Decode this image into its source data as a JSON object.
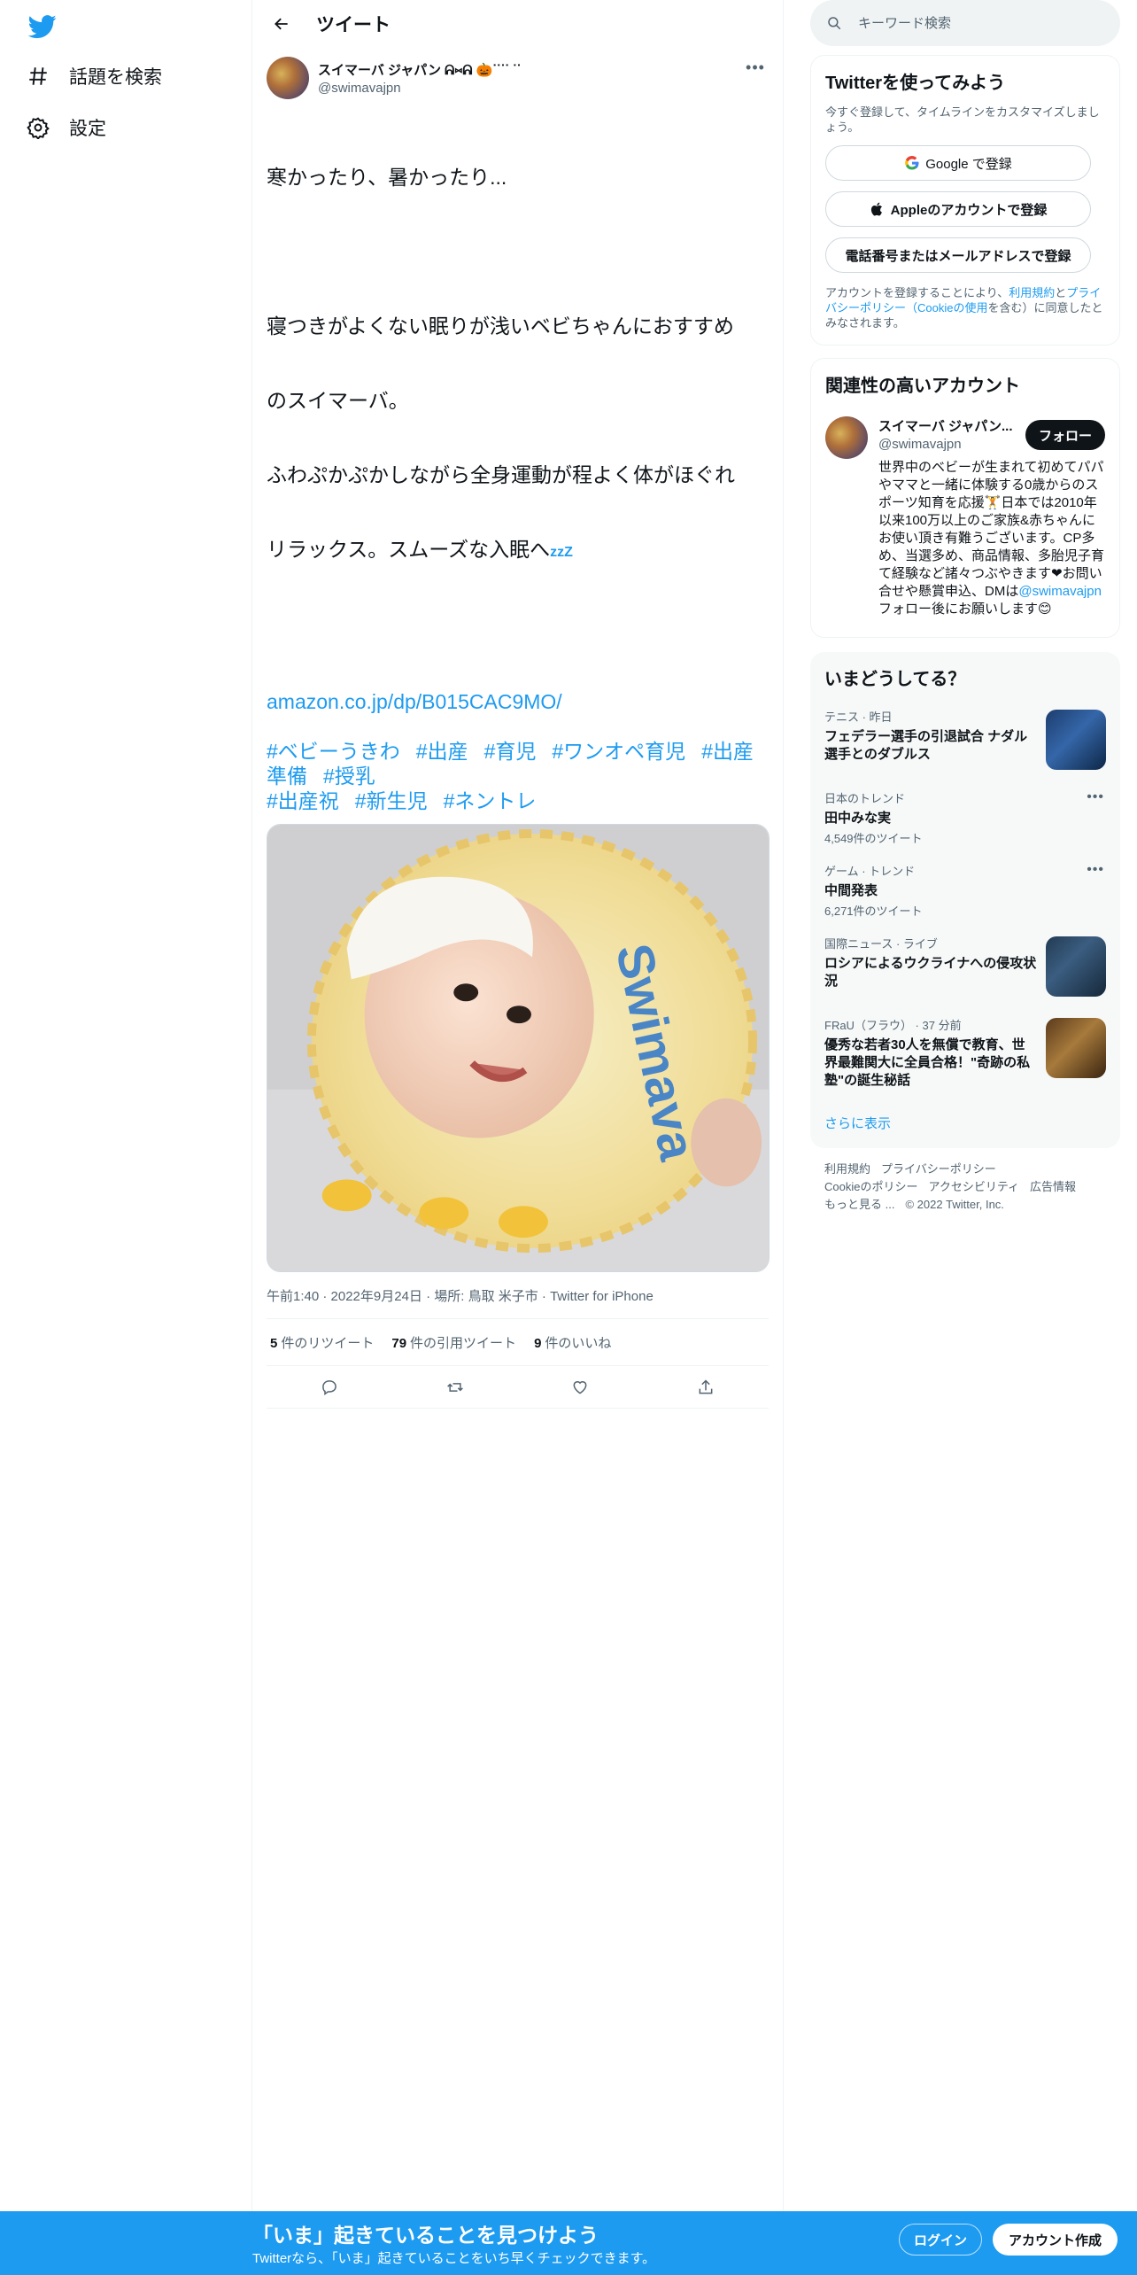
{
  "nav": {
    "logo_icon": "twitter-bird-icon",
    "items": [
      {
        "label": "話題を検索",
        "icon": "hashtag-icon"
      },
      {
        "label": "設定",
        "icon": "gear-icon"
      }
    ]
  },
  "header": {
    "title": "ツイート",
    "back_icon": "arrow-left-icon"
  },
  "tweet": {
    "author_name": "スイマーバ ジャパン ᕱ⑅ᕱ 🎃ᐝᐝᐝᐝ ᐝᐝ",
    "author_handle": "@swimavajpn",
    "text_lines": [
      "寒かったり、暑かったり...",
      "",
      "寝つきがよくない眠りが浅いベビちゃんにおすすめ",
      "のスイマーバ。",
      "ふわぷかぷかしながら全身運動が程よく体がほぐれ",
      "リラックス。スムーズな入眠へ",
      ""
    ],
    "zzz": "zzZ",
    "link": "amazon.co.jp/dp/B015CAC9MO/",
    "hashtags": [
      "#ベビーうきわ",
      "#出産",
      "#育児",
      "#ワンオペ育児",
      "#出産準備",
      "#授乳",
      "#出産祝",
      "#新生児",
      "#ネントレ"
    ],
    "media_caption": "Swimava",
    "meta": "午前1:40 · 2022年9月24日 · 場所: 鳥取 米子市 · Twitter for iPhone",
    "retweets_count": "5",
    "retweets_label": "件のリツイート",
    "quotes_count": "79",
    "quotes_label": "件の引用ツイート",
    "likes_count": "9",
    "likes_label": "件のいいね"
  },
  "search": {
    "placeholder": "キーワード検索"
  },
  "signup": {
    "title": "Twitterを使ってみよう",
    "subtitle": "今すぐ登録して、タイムラインをカスタマイズしましょう。",
    "google_label": "Google で登録",
    "apple_label": "Appleのアカウントで登録",
    "phone_label": "電話番号またはメールアドレスで登録",
    "terms_prefix": "アカウントを登録することにより、",
    "terms_link1": "利用規約",
    "terms_mid": "と",
    "terms_link2": "プライバシーポリシー（Cookieの使用",
    "terms_suffix": "を含む）に同意したとみなされます。"
  },
  "related": {
    "title": "関連性の高いアカウント",
    "name": "スイマーバ ジャパン...",
    "handle": "@swimavajpn",
    "follow_label": "フォロー",
    "bio": "世界中のベビーが生まれて初めてパパやママと一緒に体験する0歳からのスポーツ知育を応援🏋日本では2010年以来100万以上のご家族&赤ちゃんにお使い頂き有難うございます。CP多め、当選多め、商品情報、多胎児子育て経験など諸々つぶやきます❤お問い合せや懸賞申込、DMは",
    "bio_link": "@swimavajpn",
    "bio_suffix": "フォロー後にお願いします😊"
  },
  "trends": {
    "title": "いまどうしてる？",
    "items": [
      {
        "meta": "テニス · 昨日",
        "title": "フェデラー選手の引退試合 ナダル選手とのダブルス",
        "count": "",
        "has_thumb": true
      },
      {
        "meta": "日本のトレンド",
        "title": "田中みな実",
        "count": "4,549件のツイート",
        "has_thumb": false
      },
      {
        "meta": "ゲーム · トレンド",
        "title": "中間発表",
        "count": "6,271件のツイート",
        "has_thumb": false
      },
      {
        "meta": "国際ニュース · ライブ",
        "title": "ロシアによるウクライナへの侵攻状況",
        "count": "",
        "has_thumb": true
      },
      {
        "meta": "FRaU（フラウ） · 37 分前",
        "title": "優秀な若者30人を無償で教育、世界最難関大に全員合格！\"奇跡の私塾\"の誕生秘話",
        "count": "",
        "has_thumb": true
      }
    ],
    "show_more": "さらに表示"
  },
  "footer": {
    "links": [
      "利用規約",
      "プライバシーポリシー",
      "Cookieのポリシー",
      "アクセシビリティ",
      "広告情報",
      "もっと見る ...",
      "© 2022 Twitter, Inc."
    ]
  },
  "bottom_bar": {
    "title": "「いま」起きていることを見つけよう",
    "subtitle": "Twitterなら、「いま」起きていることをいち早くチェックできます。",
    "login_label": "ログイン",
    "signup_label": "アカウント作成"
  },
  "colors": {
    "brand": "#1d9bf0",
    "text": "#0f1419",
    "secondary": "#536471"
  }
}
